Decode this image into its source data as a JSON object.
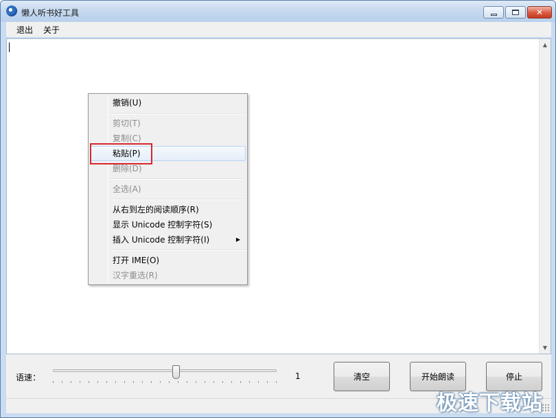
{
  "window": {
    "title": "懒人听书好工具",
    "minimize_icon": "minimize-icon",
    "maximize_icon": "maximize-icon",
    "close_icon": "close-icon",
    "close_glyph": "✕"
  },
  "menubar": {
    "items": [
      {
        "label": "退出"
      },
      {
        "label": "关于"
      }
    ]
  },
  "editor": {
    "value": ""
  },
  "context_menu": {
    "items": [
      {
        "label": "撤销(U)",
        "enabled": true
      },
      {
        "label": "剪切(T)",
        "enabled": false
      },
      {
        "label": "复制(C)",
        "enabled": false
      },
      {
        "label": "粘贴(P)",
        "enabled": true,
        "highlighted": true
      },
      {
        "label": "删除(D)",
        "enabled": false
      },
      {
        "label": "全选(A)",
        "enabled": false
      },
      {
        "label": "从右到左的阅读顺序(R)",
        "enabled": true
      },
      {
        "label": "显示 Unicode 控制字符(S)",
        "enabled": true
      },
      {
        "label": "插入 Unicode 控制字符(I)",
        "enabled": true,
        "submenu": true
      },
      {
        "label": "打开 IME(O)",
        "enabled": true
      },
      {
        "label": "汉字重选(R)",
        "enabled": false
      }
    ],
    "submenu_glyph": "▶"
  },
  "controls": {
    "speed_label": "语速：",
    "speed_value": "1",
    "speed_slider_fraction": 0.55,
    "clear_label": "清空",
    "start_read_label": "开始朗读",
    "stop_label": "停止"
  },
  "watermark": "极速下载站",
  "colors": {
    "highlight_box": "#d7262b",
    "title_bar": "#c6d9ef",
    "close_button": "#d8593f"
  }
}
